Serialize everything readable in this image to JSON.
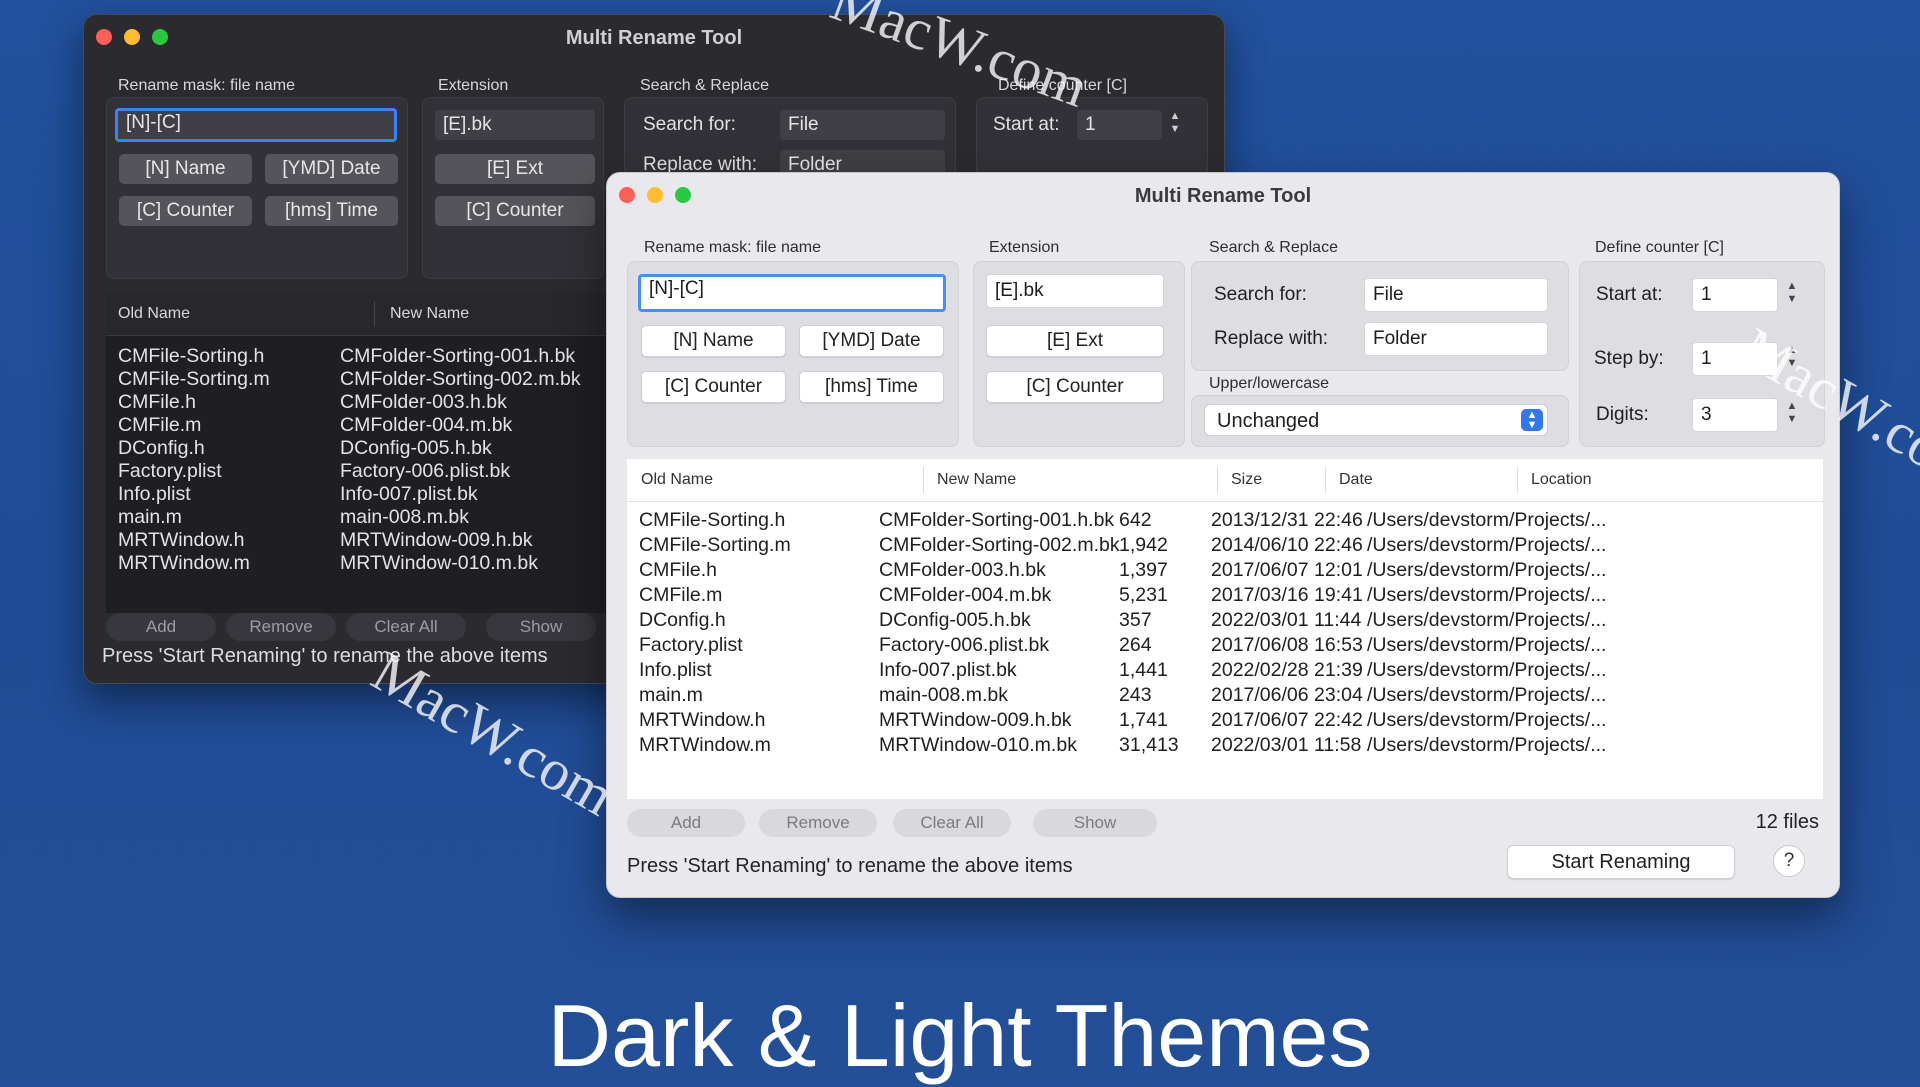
{
  "dark": {
    "title": "Multi Rename Tool",
    "mask_label": "Rename mask: file name",
    "mask_value": "[N]-[C]",
    "mask_buttons": [
      "[N] Name",
      "[YMD] Date",
      "[C] Counter",
      "[hms] Time"
    ],
    "ext_label": "Extension",
    "ext_value": "[E].bk",
    "ext_buttons": [
      "[E] Ext",
      "[C] Counter"
    ],
    "sr_label": "Search & Replace",
    "search_label": "Search for:",
    "search_value": "File",
    "replace_label": "Replace with:",
    "replace_value": "Folder",
    "counter_label": "Define counter [C]",
    "start_label": "Start at:",
    "start_value": "1",
    "columns": [
      "Old Name",
      "New Name"
    ],
    "rows": [
      [
        "CMFile-Sorting.h",
        "CMFolder-Sorting-001.h.bk"
      ],
      [
        "CMFile-Sorting.m",
        "CMFolder-Sorting-002.m.bk"
      ],
      [
        "CMFile.h",
        "CMFolder-003.h.bk"
      ],
      [
        "CMFile.m",
        "CMFolder-004.m.bk"
      ],
      [
        "DConfig.h",
        "DConfig-005.h.bk"
      ],
      [
        "Factory.plist",
        "Factory-006.plist.bk"
      ],
      [
        "Info.plist",
        "Info-007.plist.bk"
      ],
      [
        "main.m",
        "main-008.m.bk"
      ],
      [
        "MRTWindow.h",
        "MRTWindow-009.h.bk"
      ],
      [
        "MRTWindow.m",
        "MRTWindow-010.m.bk"
      ]
    ],
    "bottom_buttons": [
      "Add",
      "Remove",
      "Clear All",
      "Show"
    ],
    "status": "Press 'Start Renaming' to rename the above items"
  },
  "light": {
    "title": "Multi Rename Tool",
    "mask_label": "Rename mask: file name",
    "mask_value": "[N]-[C]",
    "mask_buttons": [
      "[N] Name",
      "[YMD] Date",
      "[C] Counter",
      "[hms] Time"
    ],
    "ext_label": "Extension",
    "ext_value": "[E].bk",
    "ext_buttons": [
      "[E] Ext",
      "[C] Counter"
    ],
    "sr_label": "Search & Replace",
    "search_label": "Search for:",
    "search_value": "File",
    "replace_label": "Replace with:",
    "replace_value": "Folder",
    "case_label": "Upper/lowercase",
    "case_value": "Unchanged",
    "counter_label": "Define counter [C]",
    "start_label": "Start at:",
    "start_value": "1",
    "step_label": "Step by:",
    "step_value": "1",
    "digits_label": "Digits:",
    "digits_value": "3",
    "columns": [
      "Old Name",
      "New Name",
      "Size",
      "Date",
      "Location"
    ],
    "rows": [
      [
        "CMFile-Sorting.h",
        "CMFolder-Sorting-001.h.bk",
        "642",
        "2013/12/31 22:46",
        "/Users/devstorm/Projects/..."
      ],
      [
        "CMFile-Sorting.m",
        "CMFolder-Sorting-002.m.bk",
        "1,942",
        "2014/06/10 22:46",
        "/Users/devstorm/Projects/..."
      ],
      [
        "CMFile.h",
        "CMFolder-003.h.bk",
        "1,397",
        "2017/06/07 12:01",
        "/Users/devstorm/Projects/..."
      ],
      [
        "CMFile.m",
        "CMFolder-004.m.bk",
        "5,231",
        "2017/03/16 19:41",
        "/Users/devstorm/Projects/..."
      ],
      [
        "DConfig.h",
        "DConfig-005.h.bk",
        "357",
        "2022/03/01 11:44",
        "/Users/devstorm/Projects/..."
      ],
      [
        "Factory.plist",
        "Factory-006.plist.bk",
        "264",
        "2017/06/08 16:53",
        "/Users/devstorm/Projects/..."
      ],
      [
        "Info.plist",
        "Info-007.plist.bk",
        "1,441",
        "2022/02/28 21:39",
        "/Users/devstorm/Projects/..."
      ],
      [
        "main.m",
        "main-008.m.bk",
        "243",
        "2017/06/06 23:04",
        "/Users/devstorm/Projects/..."
      ],
      [
        "MRTWindow.h",
        "MRTWindow-009.h.bk",
        "1,741",
        "2017/06/07 22:42",
        "/Users/devstorm/Projects/..."
      ],
      [
        "MRTWindow.m",
        "MRTWindow-010.m.bk",
        "31,413",
        "2022/03/01 11:58",
        "/Users/devstorm/Projects/..."
      ]
    ],
    "bottom_buttons": [
      "Add",
      "Remove",
      "Clear All",
      "Show"
    ],
    "file_count": "12 files",
    "status": "Press 'Start Renaming' to rename the above items",
    "start_button": "Start Renaming",
    "help_button": "?"
  },
  "watermark": "MacW.com",
  "headline": "Dark & Light Themes"
}
